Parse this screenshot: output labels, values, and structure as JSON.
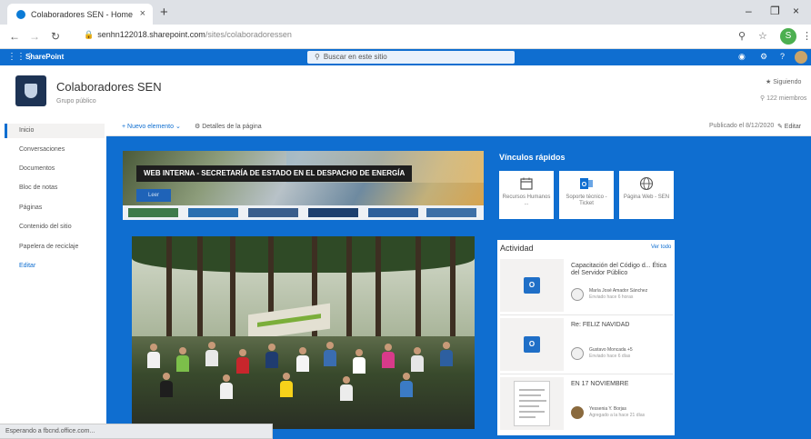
{
  "browser": {
    "tab_title": "Colaboradores SEN - Home",
    "tab_close": "×",
    "new_tab": "+",
    "url_domain": "senhn122018.sharepoint.com",
    "url_path": "/sites/colaboradoressen",
    "win_min": "–",
    "win_max": "❐",
    "win_close": "×",
    "profile_initial": "S"
  },
  "suite": {
    "brand": "SharePoint",
    "search_placeholder": "Buscar en este sitio"
  },
  "site": {
    "title": "Colaboradores SEN",
    "subtitle": "Grupo público",
    "follow": "★ Siguiendo",
    "members": "⚲ 122 miembros"
  },
  "nav": {
    "items": [
      {
        "label": "Inicio"
      },
      {
        "label": "Conversaciones"
      },
      {
        "label": "Documentos"
      },
      {
        "label": "Bloc de notas"
      },
      {
        "label": "Páginas"
      },
      {
        "label": "Contenido del sitio"
      },
      {
        "label": "Papelera de reciclaje"
      },
      {
        "label": "Editar"
      }
    ]
  },
  "command_bar": {
    "new_item": "+ Nuevo elemento ⌄",
    "page_details": "⚙ Detalles de la página",
    "published": "Publicado el 8/12/2020",
    "edit": "✎ Editar"
  },
  "banner": {
    "title": "WEB INTERNA - SECRETARÍA DE ESTADO EN EL DESPACHO DE ENERGÍA",
    "button": "Leer",
    "thumb_colors": [
      "#3d7a4a",
      "#2a6fb0",
      "#3a5e8c",
      "#1d3f6e",
      "#2d5f9a",
      "#3d6fa6"
    ]
  },
  "quick_links": {
    "title": "Vínculos rápidos",
    "items": [
      {
        "label": "Recursos Humanos ...",
        "icon": "calendar-icon"
      },
      {
        "label": "Soporte técnico - Ticket",
        "icon": "outlook-icon"
      },
      {
        "label": "Página Web - SEN",
        "icon": "globe-icon"
      }
    ]
  },
  "activity": {
    "title": "Actividad",
    "see_all": "Ver todo",
    "items": [
      {
        "title": "Capacitación del Código d... Ética del Servidor Público",
        "author": "María José Amador Sánchez",
        "when": "Enviado hace 6 horas"
      },
      {
        "title": "Re: FELIZ NAVIDAD",
        "author": "Gustavo Moncada +5",
        "when": "Enviado hace 6 días"
      },
      {
        "title": "EN 17 NOVIEMBRE",
        "author": "Yessenia Y. Borjas",
        "when": "Agregado a la hace 21 días"
      }
    ]
  },
  "status_bar": "Esperando a fbcnd.office.com..."
}
